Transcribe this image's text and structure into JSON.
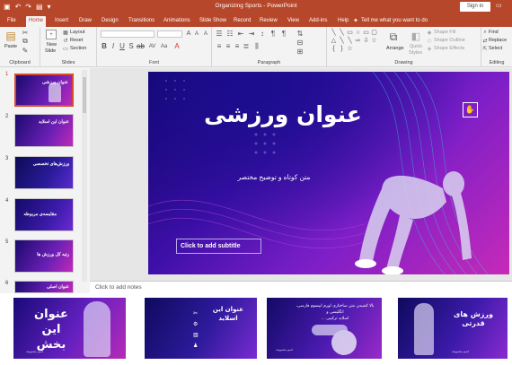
{
  "window": {
    "doc_title": "Organizing Sports  -  PowerPoint",
    "sign_in": "Sign in",
    "save_icon": "save-icon",
    "undo_icon": "undo-icon",
    "redo_icon": "redo-icon",
    "present_icon": "present-from-start-icon"
  },
  "tabs": [
    "File",
    "Home",
    "Insert",
    "Draw",
    "Design",
    "Transitions",
    "Animations",
    "Slide Show",
    "Record",
    "Review",
    "View",
    "Add-ins",
    "Help"
  ],
  "active_tab": "Home",
  "tell_me": "Tell me what you want to do",
  "ribbon": {
    "clipboard": {
      "label": "Clipboard",
      "paste": "Paste"
    },
    "slides": {
      "label": "Slides",
      "new_slide": "New",
      "new_slide2": "Slide",
      "layout": "Layout",
      "reset": "Reset",
      "section": "Section"
    },
    "font": {
      "label": "Font"
    },
    "paragraph": {
      "label": "Paragraph"
    },
    "drawing": {
      "label": "Drawing",
      "arrange": "Arrange",
      "quick_styles": "Quick",
      "quick_styles2": "Styles",
      "shape_fill": "Shape Fill",
      "shape_outline": "Shape Outline",
      "shape_effects": "Shape Effects"
    },
    "editing": {
      "label": "Editing",
      "find": "Find",
      "replace": "Replace",
      "select": "Select"
    }
  },
  "slide_numbers": [
    "1",
    "2",
    "3",
    "4",
    "5",
    "6"
  ],
  "thumb_titles": [
    "عنوان ورزشی",
    "عنوان این اسلاید",
    "ورزش‌های تخصصی",
    "مقایسه‌ی مربوطه",
    "رتبه کل ورزش ها",
    "عنوان اصلی"
  ],
  "slide": {
    "title": "عنوان ورزشی",
    "subtitle_text": "متن کوتاه و توضیح مختصر",
    "placeholder": "Click to add subtitle"
  },
  "notes_placeholder": "Click to add notes",
  "previews": [
    {
      "title_line1": "عنوان این",
      "title_line2": "بخش",
      "footer": "اسم مجموعه"
    },
    {
      "title_line1": "عنوان این",
      "title_line2": "اسلاید"
    },
    {
      "title_line1": "بالا کشیدن متن ساختاری لورم ایپسوم فارسی، انگلیسی و",
      "title_line2": "اسلاید ترکیبی ...",
      "footer": "اسم مجموعه"
    },
    {
      "title_line1": "ورزش های قدرتی",
      "footer": "اسم مجموعه"
    }
  ],
  "colors": {
    "accent": "#b7472a",
    "slide_dark": "#0f0466",
    "slide_purple": "#7a1ec8",
    "slide_pink": "#c62ab8"
  }
}
